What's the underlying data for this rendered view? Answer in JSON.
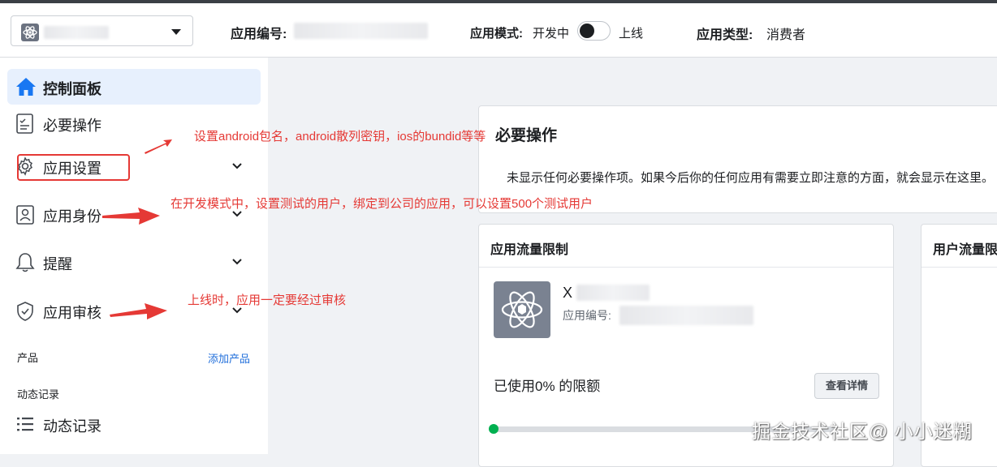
{
  "header": {
    "app_id_label": "应用编号:",
    "mode_label": "应用模式:",
    "mode_value": "开发中",
    "toggle_on_label": "上线",
    "type_label": "应用类型:",
    "type_value": "消费者"
  },
  "sidebar": {
    "items": [
      {
        "label": "控制面板",
        "icon": "home-icon",
        "active": true
      },
      {
        "label": "必要操作",
        "icon": "checklist-icon"
      },
      {
        "label": "应用设置",
        "icon": "gear-icon"
      },
      {
        "label": "应用身份",
        "icon": "id-badge-icon"
      },
      {
        "label": "提醒",
        "icon": "bell-icon"
      },
      {
        "label": "应用审核",
        "icon": "shield-check-icon"
      }
    ],
    "products_label": "产品",
    "add_product_link": "添加产品",
    "activity_section_label": "动态记录",
    "activity_item_label": "动态记录"
  },
  "main": {
    "required_card": {
      "title": "必要操作",
      "body": "未显示任何必要操作项。如果今后你的任何应用有需要立即注意的方面，就会显示在这里。"
    },
    "app_rate_card": {
      "title": "应用流量限制",
      "app_name": "X",
      "app_id_label": "应用编号:",
      "usage_text": "已使用0% 的限额",
      "details_button": "查看详情",
      "usage_percent": 0
    },
    "user_rate_card": {
      "title": "用户流量限"
    }
  },
  "annotations": {
    "settings_note": "设置android包名，android散列密钥，ios的bundid等等",
    "identity_note": "在开发模式中，设置测试的用户，绑定到公司的应用，可以设置500个测试用户",
    "review_note": "上线时，应用一定要经过审核"
  },
  "watermark": "掘金技术社区@ 小小迷糊",
  "colors": {
    "accent_blue": "#1877f2",
    "active_bg": "#e7f0fd",
    "annotation_red": "#e53935",
    "progress_green": "#00b050"
  }
}
